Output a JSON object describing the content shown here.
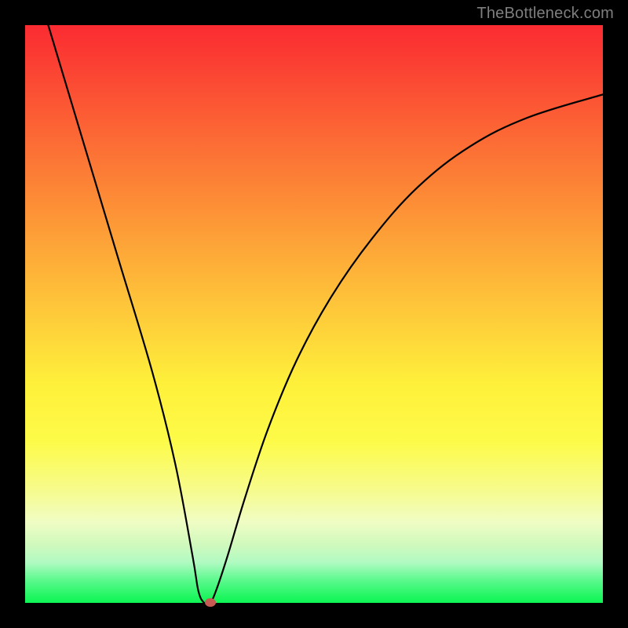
{
  "watermark": "TheBottleneck.com",
  "chart_data": {
    "type": "line",
    "title": "",
    "xlabel": "",
    "ylabel": "",
    "xlim": [
      0,
      100
    ],
    "ylim": [
      0,
      100
    ],
    "series": [
      {
        "name": "bottleneck-curve",
        "x": [
          4,
          10,
          16,
          22,
          26,
          29,
          30,
          31,
          32,
          33,
          35,
          38,
          42,
          47,
          53,
          60,
          68,
          77,
          87,
          100
        ],
        "values": [
          100,
          80,
          60,
          40,
          24,
          8,
          2,
          0,
          0,
          2,
          8,
          18,
          30,
          42,
          53,
          63,
          72,
          79,
          84,
          88
        ]
      }
    ],
    "marker": {
      "x_pct": 32,
      "y_pct": 0
    },
    "colors": {
      "curve": "#000000",
      "marker": "#c75a53",
      "gradient_top": "#fb2b32",
      "gradient_bottom": "#0ef556"
    }
  }
}
